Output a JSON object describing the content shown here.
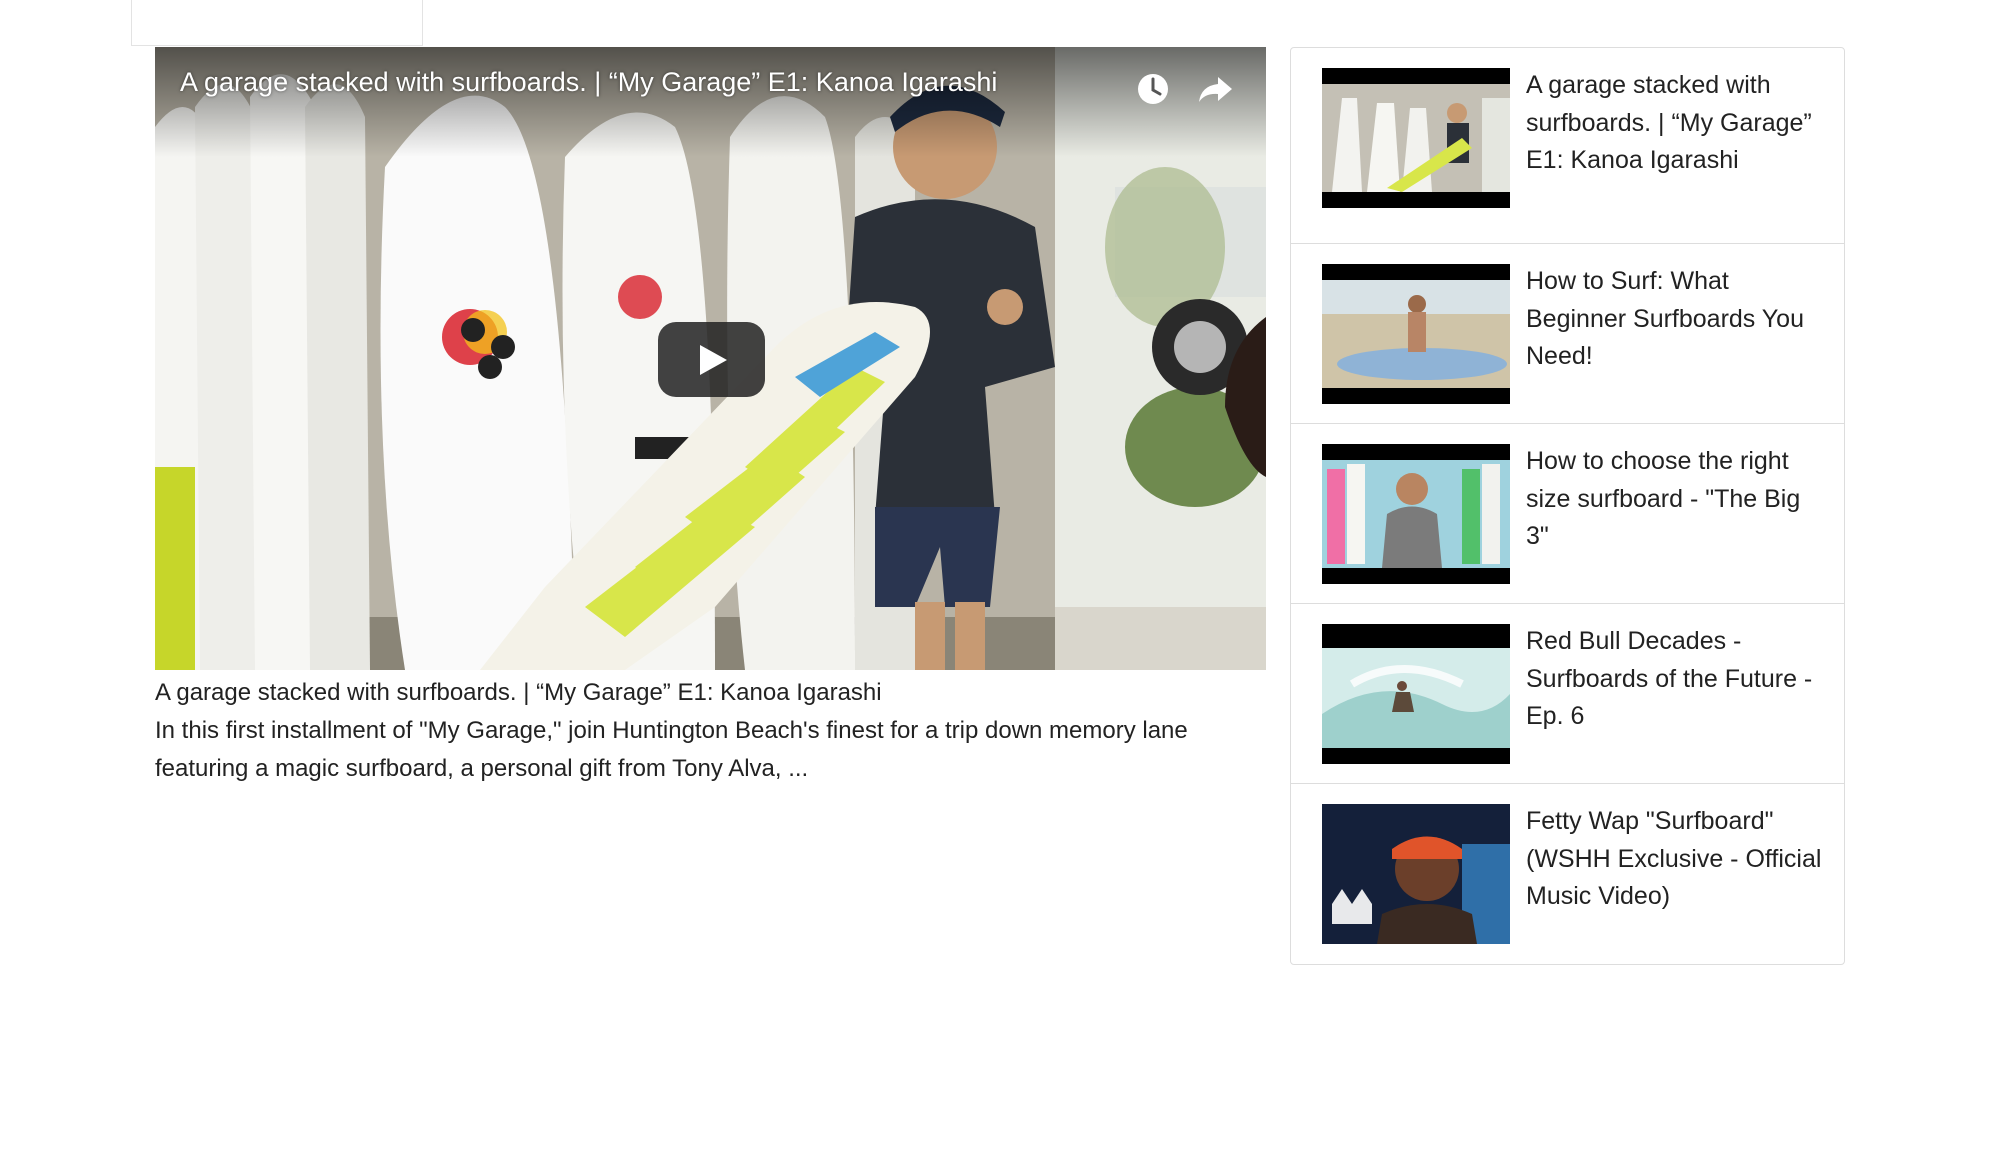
{
  "player": {
    "title": "A garage stacked with surfboards. | “My Garage” E1: Kanoa Igarashi",
    "watch_later_icon": "clock-icon",
    "share_icon": "share-arrow-icon",
    "play_icon": "play-icon"
  },
  "caption": {
    "title": "A garage stacked with surfboards. | “My Garage” E1: Kanoa Igarashi",
    "description": "In this first installment of \"My Garage,\" join Huntington Beach's finest for a trip down memory lane featuring a magic surfboard, a personal gift from Tony Alva, ..."
  },
  "related": [
    {
      "title": "A garage stacked with surfboards. | “My Garage” E1: Kanoa Igarashi"
    },
    {
      "title": "How to Surf: What Beginner Surfboards You Need!"
    },
    {
      "title": "How to choose the right size surfboard - \"The Big 3\""
    },
    {
      "title": "Red Bull Decades - Surfboards of the Future - Ep. 6"
    },
    {
      "title": "Fetty Wap \"Surfboard\" (WSHH Exclusive - Official Music Video)"
    }
  ]
}
